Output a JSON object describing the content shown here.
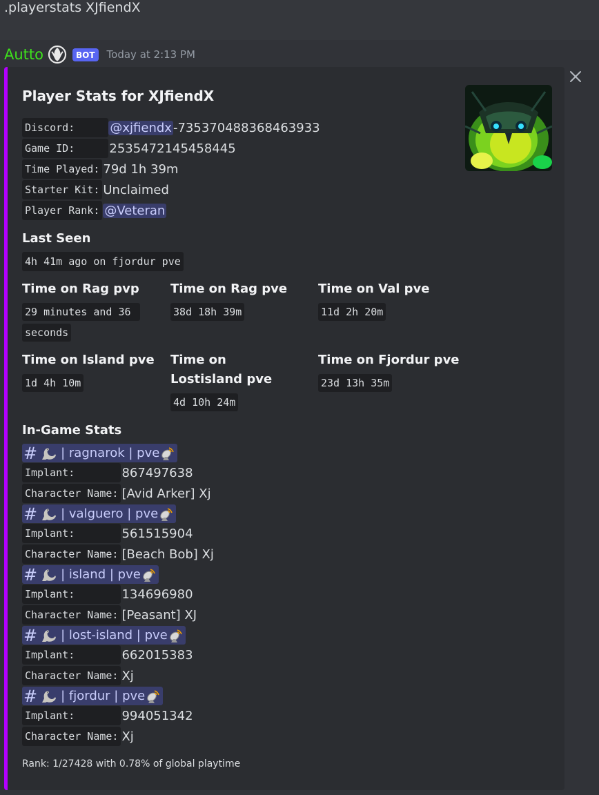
{
  "previous_message": ".playerstats XJfiendX",
  "message": {
    "author": "Autto",
    "badge": "BOT",
    "timestamp": "Today at 2:13 PM",
    "author_color": "#3ee31c"
  },
  "embed": {
    "accent_color": "#b300ff",
    "title": "Player Stats for XJfiendX",
    "fields": {
      "discord_label": "Discord:     ",
      "discord_mention": "@xjfiendx",
      "discord_id": "-735370488368463933",
      "game_id_label": "Game ID:     ",
      "game_id_value": "2535472145458445",
      "time_played_label": "Time Played:",
      "time_played_value": "79d 1h 39m",
      "starter_kit_label": "Starter Kit:",
      "starter_kit_value": "Unclaimed",
      "player_rank_label": "Player Rank:",
      "player_rank_value": "@Veteran"
    },
    "last_seen": {
      "name": "Last Seen",
      "value": "4h 41m ago on fjordur pve"
    },
    "time_on": [
      {
        "name": "Time on Rag pvp",
        "value": "29 minutes and 36 seconds"
      },
      {
        "name": "Time on Rag pve",
        "value": "38d 18h 39m"
      },
      {
        "name": "Time on Val pve",
        "value": "11d 2h 20m"
      },
      {
        "name": "Time on Island pve",
        "value": "1d 4h 10m"
      },
      {
        "name": "Time on Lostisland pve",
        "value": "4d 10h 24m"
      },
      {
        "name": "Time on Fjordur pve",
        "value": "23d 13h 35m"
      }
    ],
    "in_game_stats": {
      "name": "In-Game Stats",
      "implant_label": "Implant:       ",
      "character_label": "Character Name:",
      "servers": [
        {
          "channel": "| ragnarok | pve",
          "implant": "867497638",
          "character": "[Avid Arker] Xj"
        },
        {
          "channel": "| valguero | pve",
          "implant": "561515904",
          "character": "[Beach Bob] Xj"
        },
        {
          "channel": "| island | pve",
          "implant": "134696980",
          "character": "[Peasant] XJ"
        },
        {
          "channel": "| lost-island | pve",
          "implant": "662015383",
          "character": "Xj"
        },
        {
          "channel": "| fjordur | pve",
          "implant": "994051342",
          "character": "Xj"
        }
      ]
    },
    "footer": "Rank: 1/27428 with 0.78% of global playtime"
  }
}
